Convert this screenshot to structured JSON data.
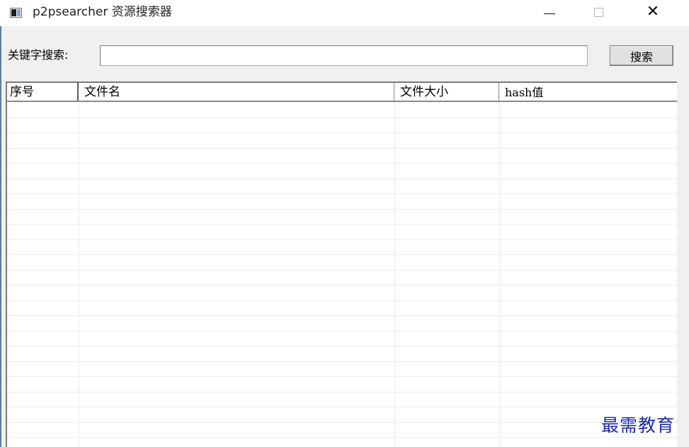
{
  "window": {
    "title": "p2psearcher 资源搜索器",
    "icon": "app-window-icon",
    "controls": {
      "minimize_icon": "minimize-icon",
      "maximize_icon": "maximize-icon",
      "close_icon": "close-icon",
      "close_glyph": "✕"
    }
  },
  "search": {
    "label": "关键字搜索:",
    "value": "",
    "placeholder": "",
    "button_label": "搜索"
  },
  "table": {
    "columns": [
      "序号",
      "文件名",
      "文件大小",
      "hash值"
    ],
    "rows": []
  },
  "watermark": "最需教育"
}
